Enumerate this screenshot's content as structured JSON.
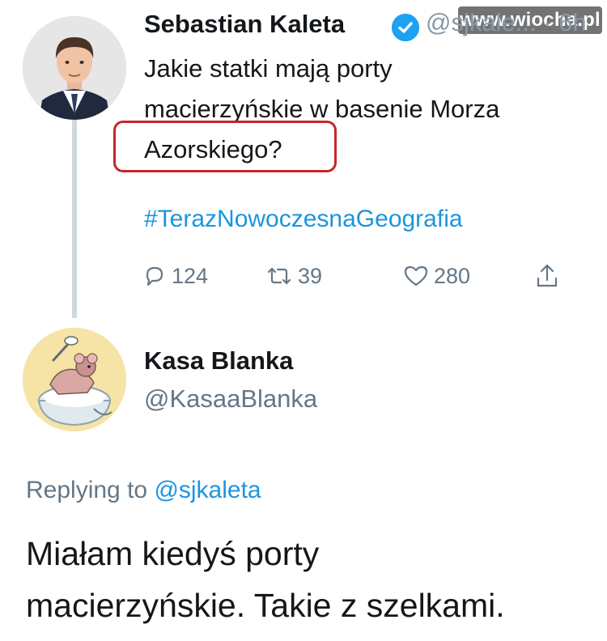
{
  "watermark": "www.wiocha.pl",
  "tweet": {
    "author_name": "Sebastian Kaleta",
    "author_handle": "@sjkale... · 6h",
    "verified": true,
    "text_line_1": "Jakie statki mają porty",
    "text_line_2": "macierzyńskie w basenie Morza",
    "text_highlighted": "Azorskiego?",
    "hashtag": "#TerazNowoczesnaGeografia",
    "reply_count": "124",
    "retweet_count": "39",
    "like_count": "280",
    "icons": [
      "reply-icon",
      "retweet-icon",
      "heart-icon",
      "share-icon",
      "verified-badge-icon"
    ],
    "highlight_color": "#c5262a"
  },
  "reply": {
    "author_name": "Kasa Blanka",
    "author_handle": "@KasaaBlanka",
    "replying_prefix": "Replying to",
    "replying_handle": "@sjkaleta",
    "text_line_1": "Miałam kiedyś porty",
    "text_line_2": "macierzyńskie. Takie z szelkami."
  },
  "colors": {
    "link_blue": "#1b95e0",
    "muted_gray": "#657786",
    "text": "#14171a"
  }
}
